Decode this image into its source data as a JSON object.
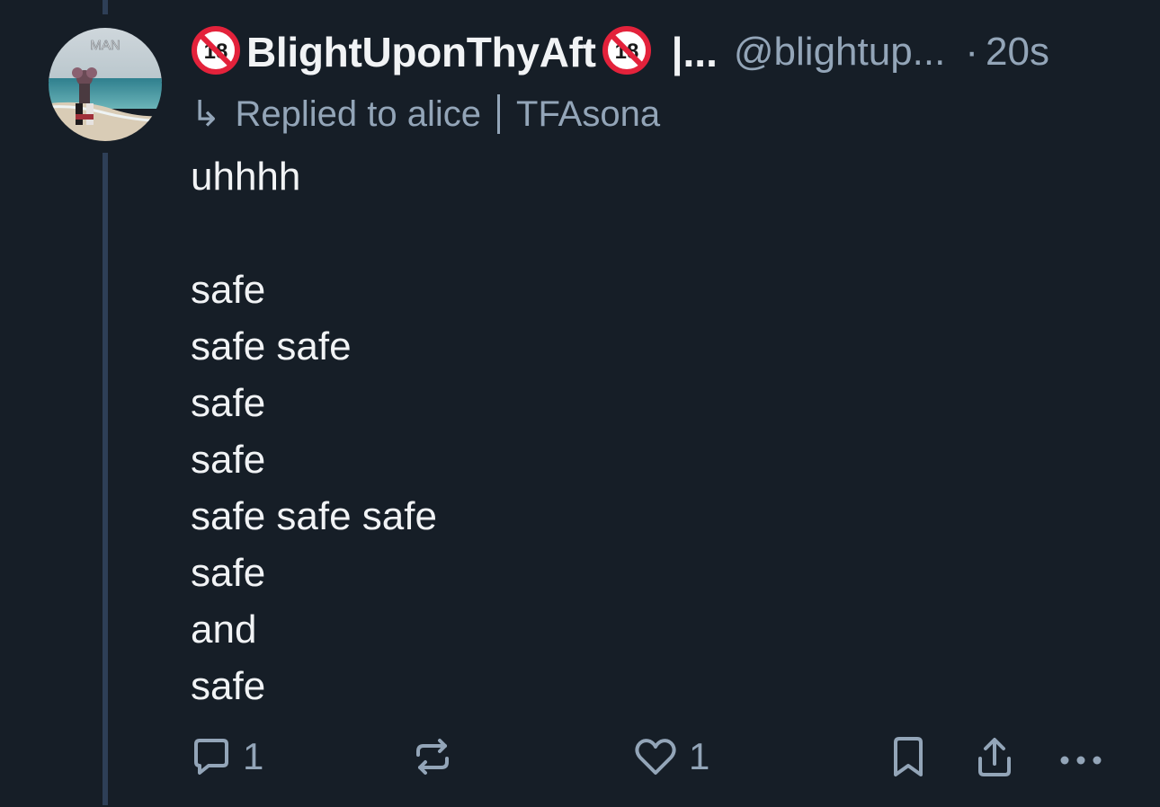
{
  "avatar": {
    "overlay_text": "MAN"
  },
  "header": {
    "badge_icon": "no-under-18-icon",
    "display_name": "BlightUponThyAft",
    "name_suffix": "|...",
    "handle": "@blightup...",
    "separator": "·",
    "timestamp": "20s"
  },
  "reply": {
    "arrow": "↳",
    "text": "Replied to alice",
    "tag": "TFAsona"
  },
  "body": {
    "lines": [
      "uhhhh",
      "",
      "safe",
      "safe safe",
      "safe",
      "safe",
      "safe safe safe",
      "safe",
      "and",
      "safe"
    ]
  },
  "actions": {
    "reply_count": "1",
    "like_count": "1"
  },
  "colors": {
    "background": "#161e27",
    "thread_line": "#2e3f57",
    "text_primary": "#f1f3f5",
    "text_secondary": "#93a5b8",
    "badge_red": "#e3223b"
  }
}
